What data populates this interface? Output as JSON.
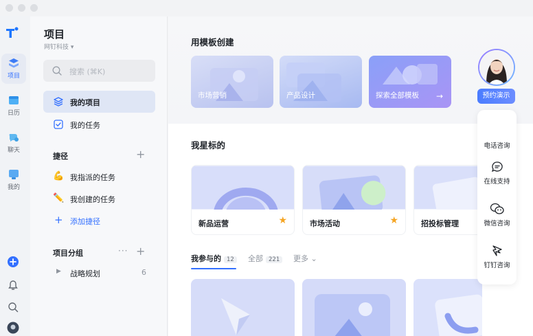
{
  "sidebar": {
    "title": "项目",
    "org": "网钉科技 ▾",
    "search_placeholder": "搜索 (⌘K)",
    "nav": [
      {
        "label": "我的项目",
        "icon": "layers-icon"
      },
      {
        "label": "我的任务",
        "icon": "checkbox-icon"
      }
    ],
    "shortcuts_title": "捷径",
    "shortcuts": [
      {
        "label": "我指派的任务",
        "icon": "💪"
      },
      {
        "label": "我创建的任务",
        "icon": "✏️"
      },
      {
        "label": "添加捷径",
        "icon": "+"
      }
    ],
    "groups_title": "项目分组",
    "groups": [
      {
        "label": "战略规划",
        "count": "6"
      }
    ]
  },
  "rail": {
    "items": [
      {
        "label": "项目",
        "icon": "project-icon"
      },
      {
        "label": "日历",
        "icon": "calendar-icon"
      },
      {
        "label": "聊天",
        "icon": "chat-icon"
      },
      {
        "label": "我的",
        "icon": "profile-icon"
      }
    ]
  },
  "main": {
    "templates_title": "用模板创建",
    "templates": [
      "市场营销",
      "产品设计",
      "探索全部模板"
    ],
    "starred_title": "我星标的",
    "starred": [
      "新品运营",
      "市场活动",
      "招投标管理"
    ],
    "tabs": {
      "participating": "我参与的",
      "participating_count": "12",
      "all": "全部",
      "all_count": "221",
      "more": "更多 ⌄"
    }
  },
  "consult": {
    "demo": "预约演示",
    "items": [
      "电话咨询",
      "在线支持",
      "微信咨询",
      "钉钉咨询"
    ]
  },
  "colors": {
    "accent": "#3370ff",
    "star": "#f5a524"
  }
}
